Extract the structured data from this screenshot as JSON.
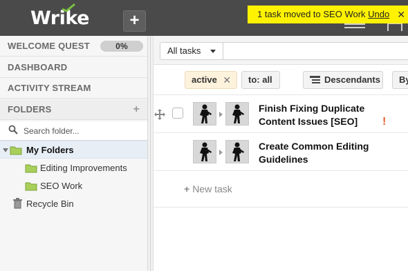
{
  "app": {
    "logo_text": "Wrike",
    "new_button_label": "+"
  },
  "notification": {
    "message": "1 task moved to SEO Work",
    "undo_label": "Undo",
    "close_label": "✕"
  },
  "sidebar": {
    "welcome_quest": {
      "label": "WELCOME QUEST",
      "progress": "0%"
    },
    "dashboard_label": "DASHBOARD",
    "activity_label": "ACTIVITY STREAM",
    "folders_label": "FOLDERS",
    "folders_add": "+",
    "search_placeholder": "Search folder...",
    "tree": {
      "my_folders": "My Folders",
      "editing": "Editing Improvements",
      "seo": "SEO Work",
      "recycle": "Recycle Bin"
    }
  },
  "toolbar": {
    "view_select": "All tasks"
  },
  "filters": {
    "status": "active",
    "status_remove": "✕",
    "assignee": "to: all",
    "descendants": "Descendants",
    "sort": "By"
  },
  "tasks": [
    {
      "title": "Finish Fixing Duplicate Content Issues [SEO]",
      "important": "!"
    },
    {
      "title": "Create Common Editing Guidelines",
      "important": ""
    }
  ],
  "new_task": {
    "plus": "+",
    "label": "New task"
  },
  "colors": {
    "topbar": "#4a4a4a",
    "notice": "#fff200",
    "selected_folder": "#e7eef6",
    "important": "#e8602c"
  }
}
